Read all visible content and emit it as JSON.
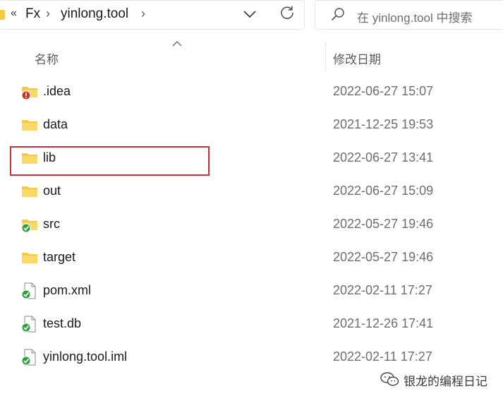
{
  "address_bar": {
    "overflow_label": "«",
    "breadcrumbs": [
      "Fx",
      "yinlong.tool"
    ],
    "separator": "›"
  },
  "search": {
    "placeholder": "在 yinlong.tool 中搜索"
  },
  "columns": {
    "name": "名称",
    "date_modified": "修改日期"
  },
  "files": [
    {
      "name": ".idea",
      "date": "2022-06-27 15:07",
      "icon": "folder-error-icon"
    },
    {
      "name": "data",
      "date": "2021-12-25 19:53",
      "icon": "folder-icon"
    },
    {
      "name": "lib",
      "date": "2022-06-27 13:41",
      "icon": "folder-icon",
      "highlighted": true
    },
    {
      "name": "out",
      "date": "2022-06-27 15:09",
      "icon": "folder-icon"
    },
    {
      "name": "src",
      "date": "2022-05-27 19:46",
      "icon": "folder-synced-icon"
    },
    {
      "name": "target",
      "date": "2022-05-27 19:46",
      "icon": "folder-icon"
    },
    {
      "name": "pom.xml",
      "date": "2022-02-11 17:27",
      "icon": "file-synced-icon"
    },
    {
      "name": "test.db",
      "date": "2021-12-26 17:41",
      "icon": "file-synced-icon"
    },
    {
      "name": "yinlong.tool.iml",
      "date": "2022-02-11 17:27",
      "icon": "file-synced-icon"
    }
  ],
  "watermark": {
    "text": "银龙的编程日记"
  },
  "colors": {
    "folder": "#f8c842",
    "highlight_border": "#c8323a",
    "synced_badge": "#2e9e3a",
    "error_badge": "#c0392b"
  }
}
